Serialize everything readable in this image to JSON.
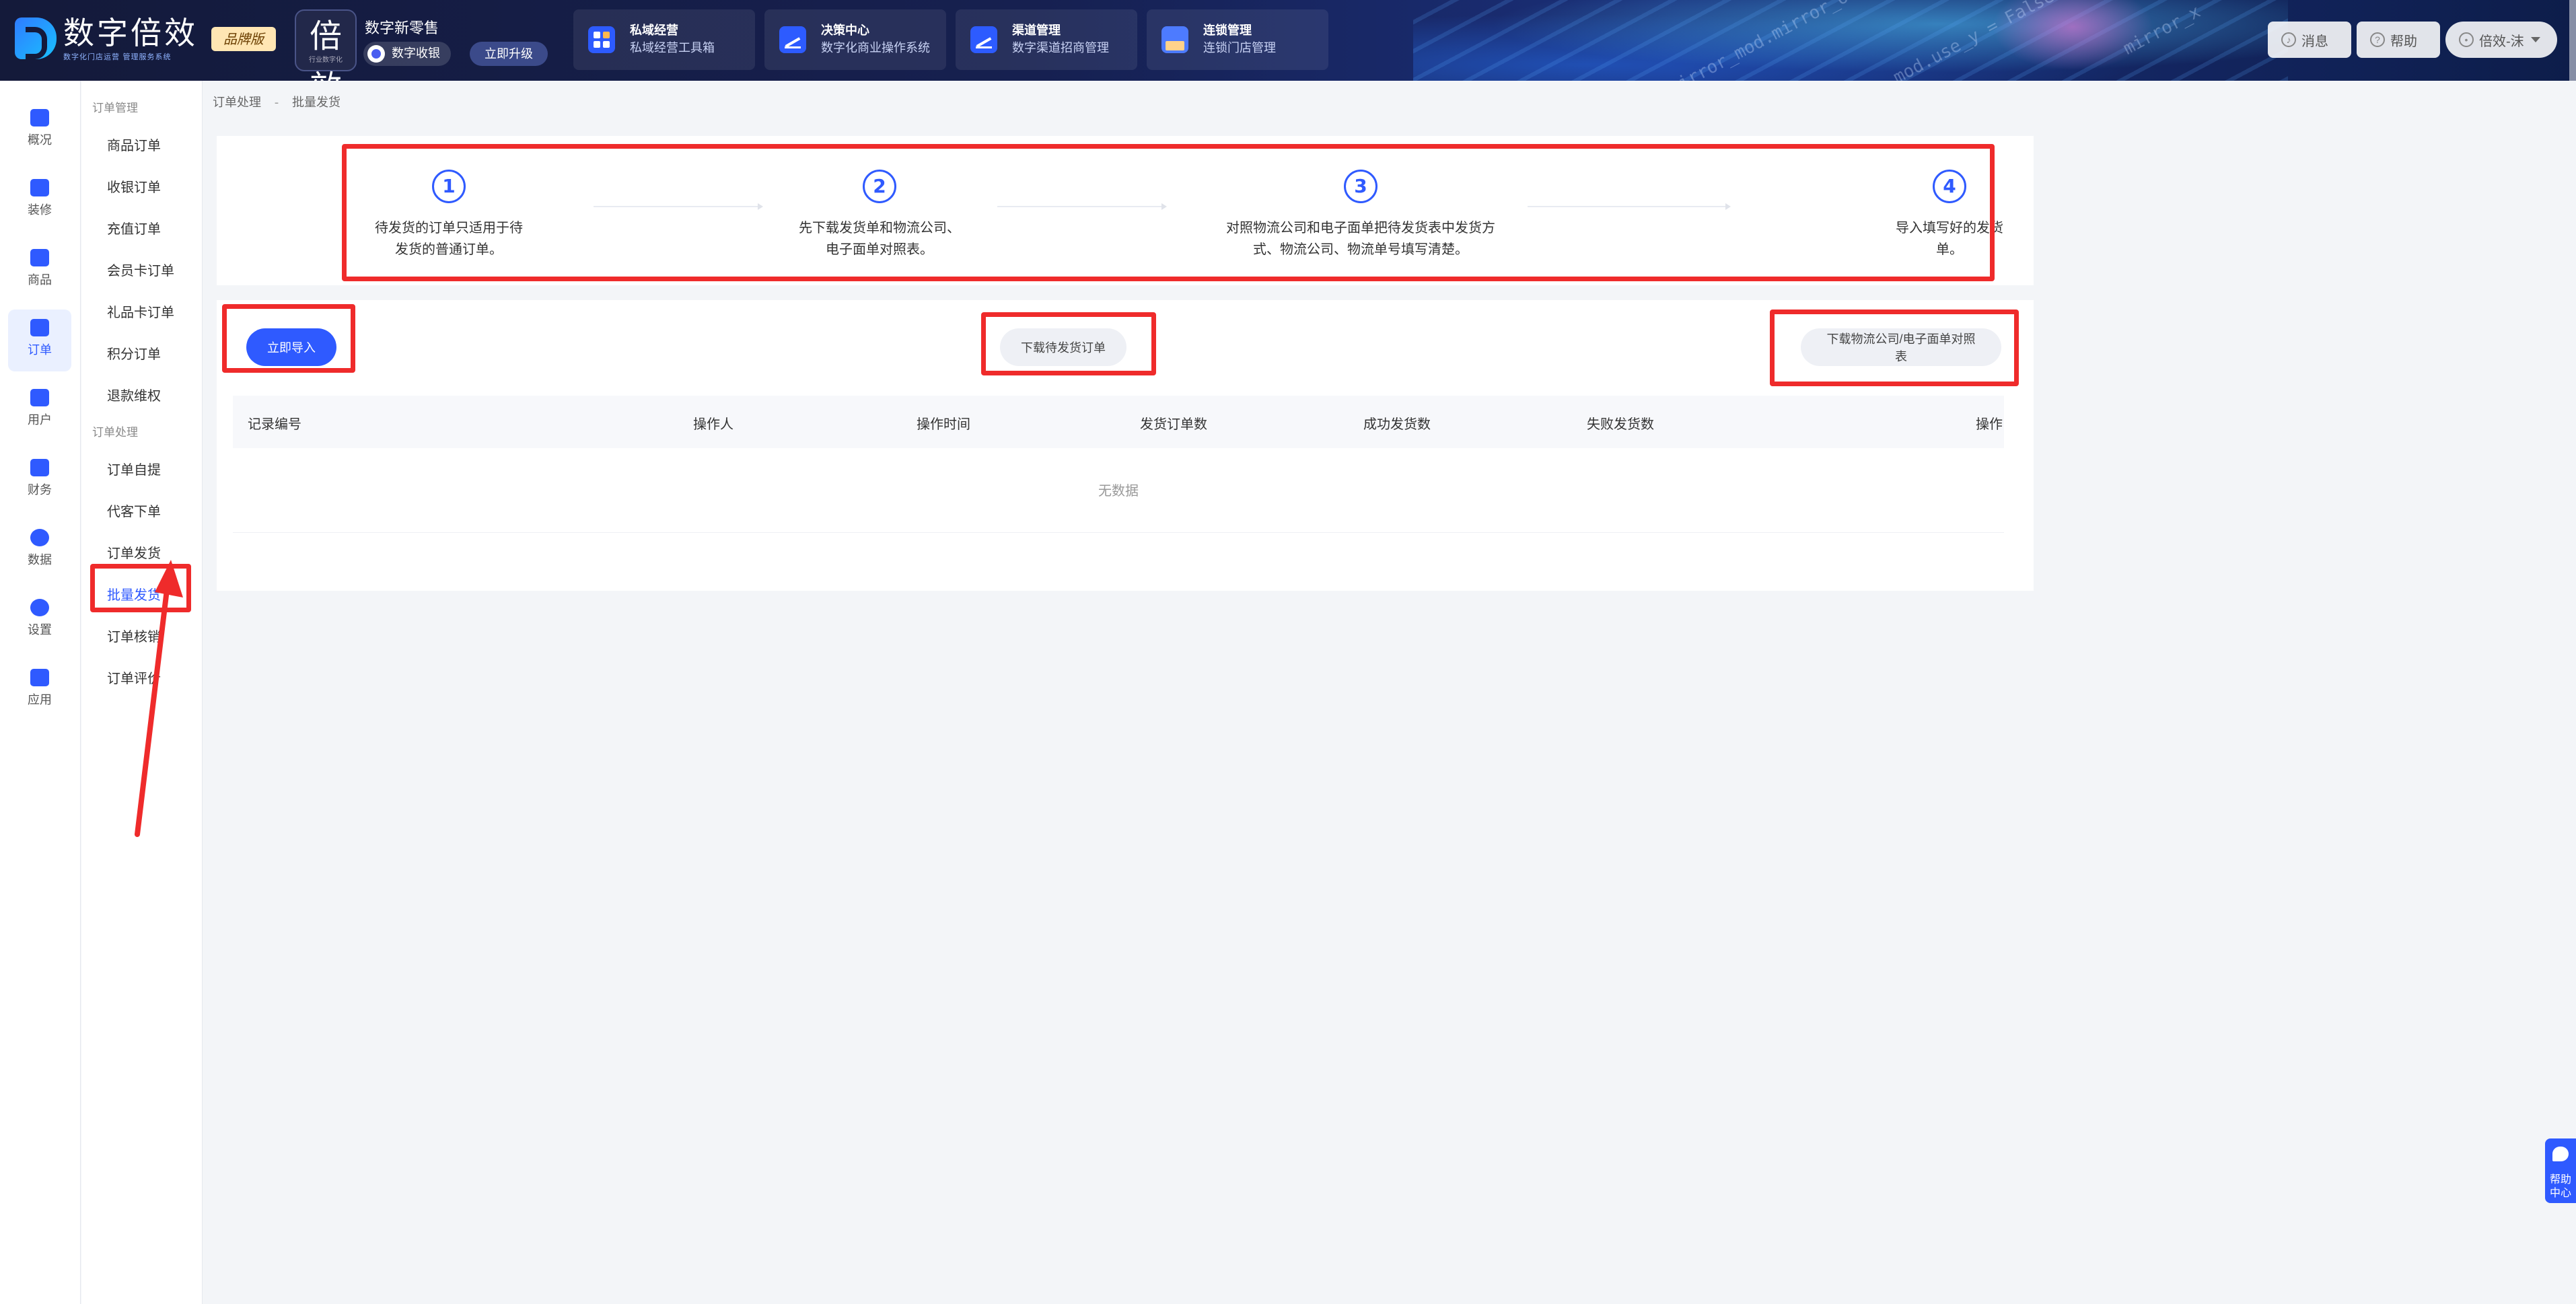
{
  "brand": {
    "logo_title": "数字倍效",
    "logo_sub": "数字化门店运营 管理服务系统",
    "tag": "品牌版"
  },
  "store": {
    "avatar_text": "倍效",
    "avatar_sub": "行业数字化",
    "name": "数字新零售",
    "badge": "数字收银",
    "upgrade": "立即升级"
  },
  "topnav": [
    {
      "title": "私域经营",
      "sub": "私域经营工具箱",
      "icon": "grid-icon"
    },
    {
      "title": "决策中心",
      "sub": "数字化商业操作系统",
      "icon": "chart-icon"
    },
    {
      "title": "渠道管理",
      "sub": "数字渠道招商管理",
      "icon": "chart-icon"
    },
    {
      "title": "连锁管理",
      "sub": "连锁门店管理",
      "icon": "shop-icon"
    }
  ],
  "header_actions": {
    "message": "消息",
    "help": "帮助",
    "user": "倍效-沫"
  },
  "rail": [
    {
      "label": "概况",
      "icon": "overview-icon"
    },
    {
      "label": "装修",
      "icon": "brush-icon"
    },
    {
      "label": "商品",
      "icon": "goods-icon"
    },
    {
      "label": "订单",
      "icon": "order-icon"
    },
    {
      "label": "用户",
      "icon": "user-icon"
    },
    {
      "label": "财务",
      "icon": "finance-icon"
    },
    {
      "label": "数据",
      "icon": "pie-chart-icon"
    },
    {
      "label": "设置",
      "icon": "gear-icon"
    },
    {
      "label": "应用",
      "icon": "apps-icon"
    }
  ],
  "submenu": {
    "group1": "订单管理",
    "items1": [
      "商品订单",
      "收银订单",
      "充值订单",
      "会员卡订单",
      "礼品卡订单",
      "积分订单",
      "退款维权"
    ],
    "group2": "订单处理",
    "items2": [
      "订单自提",
      "代客下单",
      "订单发货",
      "批量发货",
      "订单核销",
      "订单评价"
    ]
  },
  "breadcrumb": {
    "parent": "订单处理",
    "sep": "-",
    "current": "批量发货"
  },
  "steps": [
    {
      "num": "1",
      "line1": "待发货的订单只适用于待",
      "line2": "发货的普通订单。"
    },
    {
      "num": "2",
      "line1": "先下载发货单和物流公司、",
      "line2": "电子面单对照表。"
    },
    {
      "num": "3",
      "line1": "对照物流公司和电子面单把待发货表中发货方",
      "line2": "式、物流公司、物流单号填写清楚。"
    },
    {
      "num": "4",
      "line1": "导入填写好的发货",
      "line2": "单。"
    }
  ],
  "actions": {
    "import": "立即导入",
    "download_orders": "下载待发货订单",
    "download_mapping": "下载物流公司/电子面单对照表"
  },
  "table": {
    "columns": [
      "记录编号",
      "操作人",
      "操作时间",
      "发货订单数",
      "成功发货数",
      "失败发货数",
      "操作"
    ],
    "empty": "无数据"
  },
  "help_center": "帮助中心"
}
